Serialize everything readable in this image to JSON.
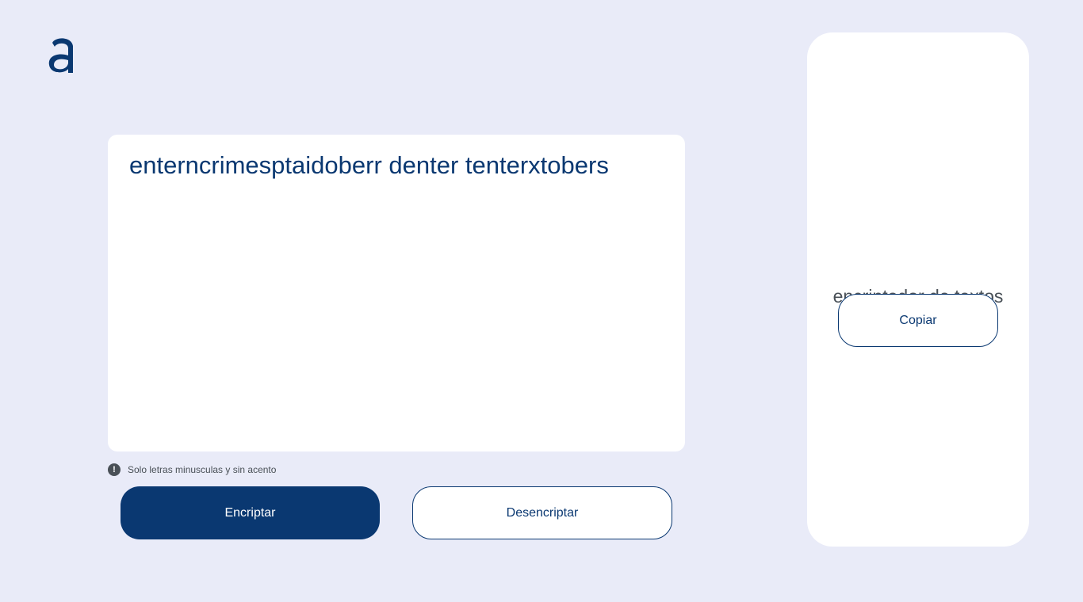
{
  "logo": {
    "icon": "alura-a-logo-icon",
    "color": "#0a3871"
  },
  "input": {
    "value": "enterncrimesptaidoberr denter tenterxtobers"
  },
  "hint": {
    "icon": "exclamation-circle-icon",
    "text": "Solo letras minusculas y sin acento"
  },
  "buttons": {
    "encrypt_label": "Encriptar",
    "decrypt_label": "Desencriptar"
  },
  "output": {
    "title": "encriptador de textos",
    "copy_label": "Copiar"
  },
  "colors": {
    "background": "#e9ebf8",
    "primary": "#0a3871",
    "text_muted": "#495057",
    "card": "#ffffff"
  }
}
